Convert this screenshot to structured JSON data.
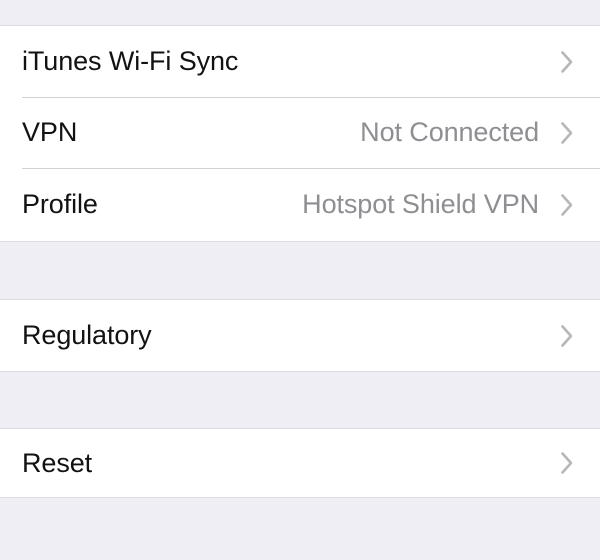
{
  "screen": {
    "name": "ios-settings-general",
    "background_color": "#efeef4",
    "row_background_color": "#ffffff",
    "separator_color": "#d2d1d6",
    "label_color": "#121212",
    "value_color": "#8e8e93",
    "chevron_color": "#b6b6bb"
  },
  "sections": [
    {
      "id": "connectivity",
      "rows": [
        {
          "name": "itunes-wifi-sync",
          "label": "iTunes Wi-Fi Sync",
          "value": "",
          "accessory": "chevron-right-icon"
        },
        {
          "name": "vpn",
          "label": "VPN",
          "value": "Not Connected",
          "accessory": "chevron-right-icon"
        },
        {
          "name": "profile",
          "label": "Profile",
          "value": "Hotspot Shield VPN",
          "accessory": "chevron-right-icon"
        }
      ]
    },
    {
      "id": "regulatory",
      "rows": [
        {
          "name": "regulatory",
          "label": "Regulatory",
          "value": "",
          "accessory": "chevron-right-icon"
        }
      ]
    },
    {
      "id": "reset",
      "rows": [
        {
          "name": "reset",
          "label": "Reset",
          "value": "",
          "accessory": "chevron-right-icon"
        }
      ]
    }
  ]
}
